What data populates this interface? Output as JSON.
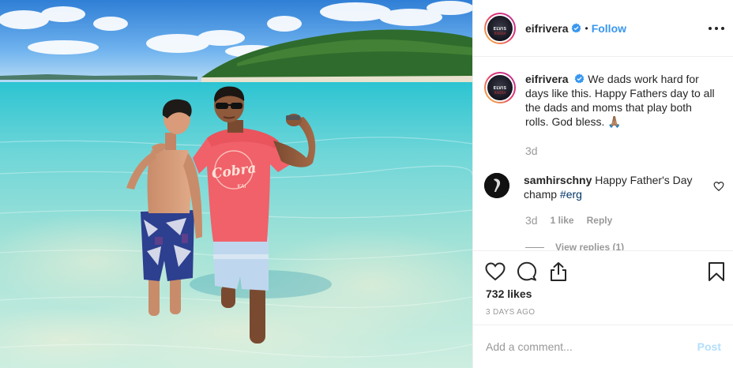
{
  "post": {
    "username": "eifrivera",
    "follow_label": "Follow",
    "separator": "•",
    "caption": {
      "username": "eifrivera",
      "text": "We dads work hard for days like this. Happy Fathers day to all the dads and moms that play both rolls. God bless. 🙏🏽",
      "time": "3d"
    },
    "comment": {
      "username": "samhirschny",
      "text": "Happy Father's Day champ",
      "hashtag": "#erg",
      "time": "3d",
      "likes": "1 like",
      "reply_label": "Reply",
      "view_replies": "View replies (1)"
    },
    "likes": "732 likes",
    "date": "3 DAYS AGO",
    "add_comment_placeholder": "Add a comment...",
    "post_button": "Post",
    "avatar_badge_line1": "ELVIS",
    "avatar_badge_line2": "RIVERA"
  },
  "photo": {
    "shirt_text": "Cobra Kai"
  },
  "colors": {
    "link_blue": "#3897f0",
    "post_disabled": "#b2dffc",
    "muted": "#999999",
    "hashtag": "#003569"
  }
}
